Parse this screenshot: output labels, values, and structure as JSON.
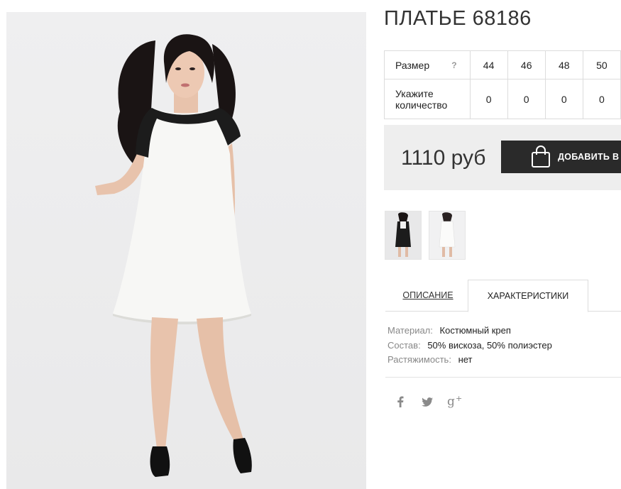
{
  "product": {
    "title": "ПЛАТЬЕ 68186"
  },
  "sizes": {
    "size_label": "Размер",
    "help_mark": "?",
    "qty_label": "Укажите количество",
    "values": [
      "44",
      "46",
      "48",
      "50"
    ],
    "quantities": [
      "0",
      "0",
      "0",
      "0"
    ]
  },
  "purchase": {
    "price": "1110 руб",
    "add_button_label": "ДОБАВИТЬ В З"
  },
  "tabs": {
    "description": "ОПИСАНИЕ",
    "characteristics": "ХАРАКТЕРИСТИКИ",
    "active": "characteristics"
  },
  "specs": [
    {
      "key": "Материал:",
      "value": "Костюмный креп"
    },
    {
      "key": "Состав:",
      "value": "50% вискоза, 50% полиэстер"
    },
    {
      "key": "Растяжимость:",
      "value": "нет"
    }
  ],
  "social": [
    "facebook-icon",
    "twitter-icon",
    "google-plus-icon"
  ],
  "colors": {
    "button_bg": "#2a2a2a",
    "price_box_bg": "#eeeeee",
    "dress_white": "#f7f7f5",
    "dress_black": "#1c1c1c"
  }
}
